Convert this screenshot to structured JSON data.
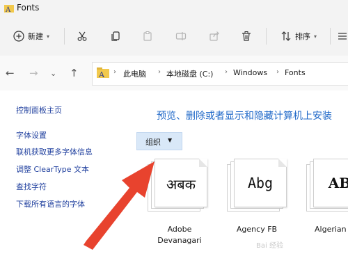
{
  "window": {
    "title": "Fonts",
    "icon": "fonts-folder-icon"
  },
  "toolbar": {
    "new_label": "新建",
    "sort_label": "排序",
    "icons": [
      "plus-circle-icon",
      "cut-icon",
      "copy-icon",
      "paste-icon",
      "rename-icon",
      "share-icon",
      "delete-icon",
      "sort-icon",
      "more-icon"
    ]
  },
  "address": {
    "path": [
      "此电脑",
      "本地磁盘 (C:)",
      "Windows",
      "Fonts"
    ]
  },
  "sidebar": {
    "links": [
      "控制面板主页",
      "字体设置",
      "联机获取更多字体信息",
      "调整 ClearType 文本",
      "查找字符",
      "下载所有语言的字体"
    ]
  },
  "main": {
    "heading": "预览、删除或者显示和隐藏计算机上安装",
    "organize_label": "组织",
    "fonts": [
      {
        "sample": "अबक",
        "name_line1": "Adobe",
        "name_line2": "Devanagari"
      },
      {
        "sample": "Abg",
        "name_line1": "Agency FB",
        "name_line2": ""
      },
      {
        "sample": "AB",
        "name_line1": "Algerian",
        "name_line2": ""
      }
    ]
  },
  "overlay": {
    "arrow_color": "#e8432e"
  },
  "watermark": "Bai 经验"
}
